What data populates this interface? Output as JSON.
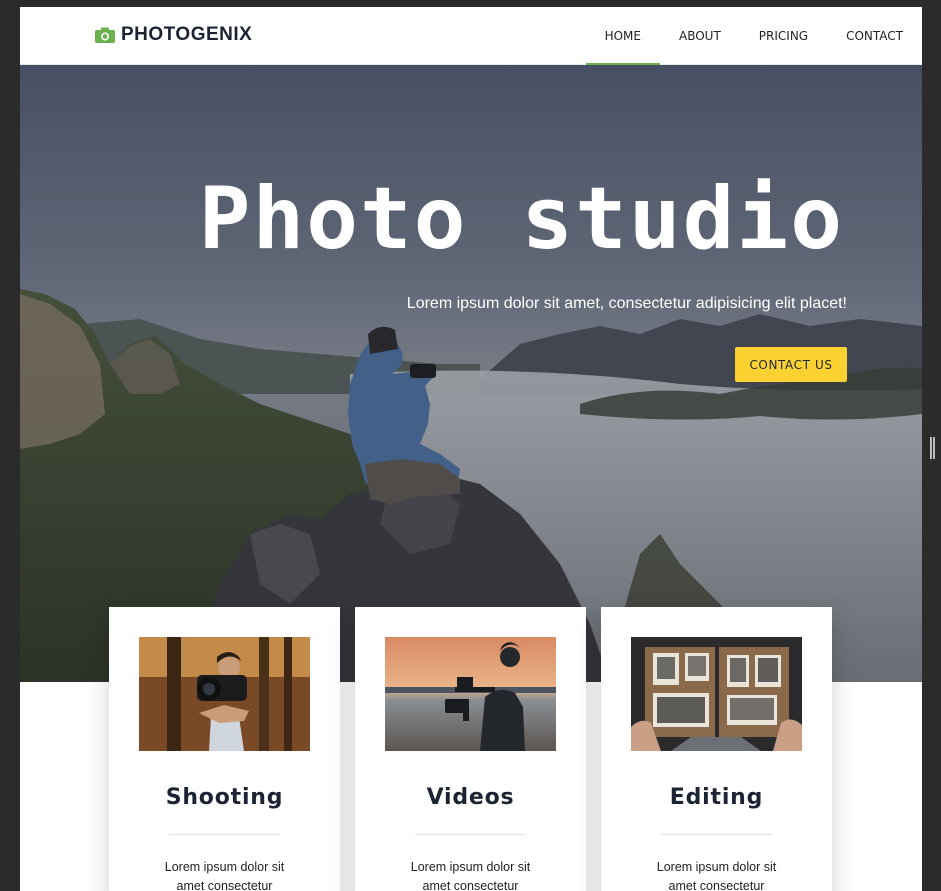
{
  "brand": {
    "name": "PHOTOGENIX",
    "icon": "camera-icon",
    "accent_color": "#6ab04c"
  },
  "nav": {
    "items": [
      {
        "label": "HOME",
        "active": true
      },
      {
        "label": "ABOUT",
        "active": false
      },
      {
        "label": "PRICING",
        "active": false
      },
      {
        "label": "CONTACT",
        "active": false
      }
    ]
  },
  "hero": {
    "title": "Photo studio",
    "subtitle": "Lorem ipsum dolor sit amet, consectetur adipisicing elit placet!",
    "cta_label": "CONTACT US",
    "cta_color": "#fcd232"
  },
  "services": [
    {
      "title": "Shooting",
      "text": "Lorem ipsum dolor sit amet consectetur",
      "image": "photographer-with-camera-photo"
    },
    {
      "title": "Videos",
      "text": "Lorem ipsum dolor sit amet consectetur",
      "image": "videographer-sunset-photo"
    },
    {
      "title": "Editing",
      "text": "Lorem ipsum dolor sit amet consectetur",
      "image": "photo-album-photo"
    }
  ]
}
